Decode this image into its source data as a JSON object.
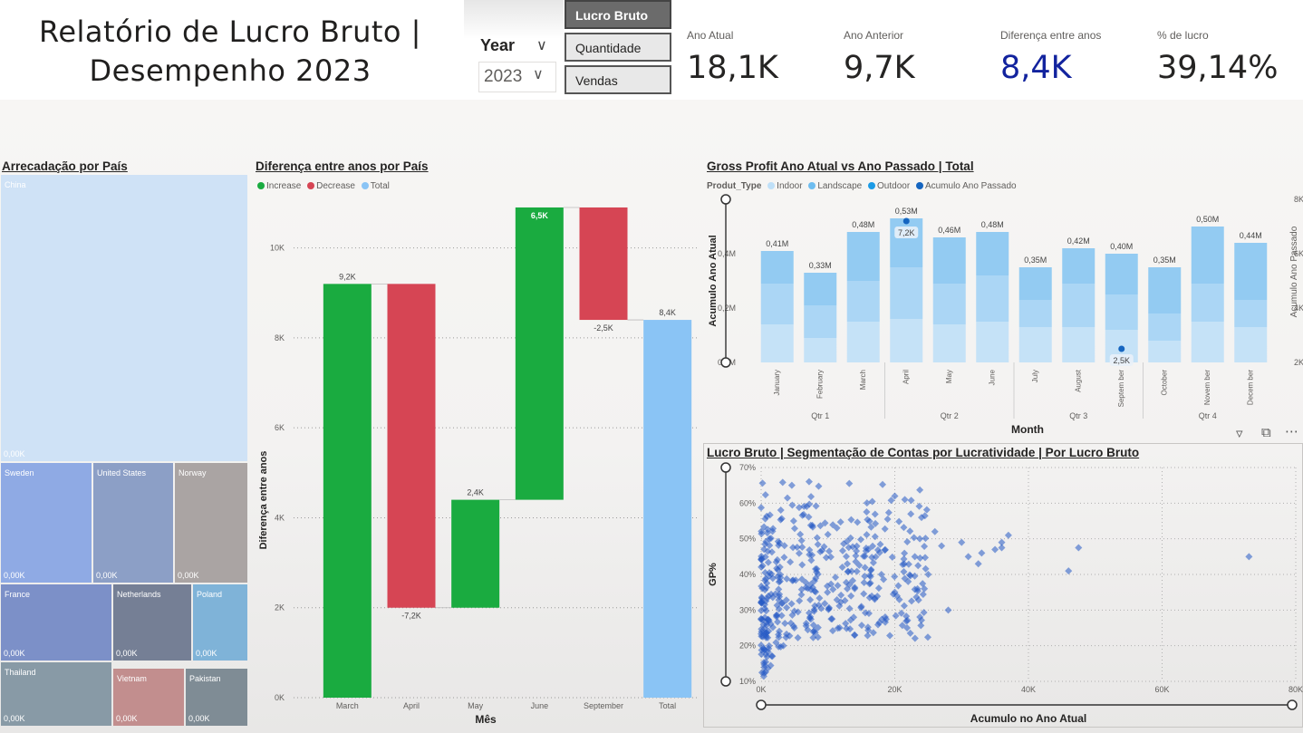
{
  "header": {
    "title_line1": "Relatório de Lucro Bruto |",
    "title_line2": "Desempenho 2023",
    "year_slicer": {
      "label": "Year",
      "value": "2023"
    },
    "measure_buttons": [
      {
        "label": "Lucro Bruto",
        "selected": true
      },
      {
        "label": "Quantidade",
        "selected": false
      },
      {
        "label": "Vendas",
        "selected": false
      }
    ],
    "kpis": [
      {
        "label": "Ano Atual",
        "value": "18,1K",
        "color": "#252423"
      },
      {
        "label": "Ano Anterior",
        "value": "9,7K",
        "color": "#252423"
      },
      {
        "label": "Diferença entre anos",
        "value": "8,4K",
        "color": "#12239e"
      },
      {
        "label": "% de lucro",
        "value": "39,14%",
        "color": "#252423"
      }
    ]
  },
  "treemap": {
    "title": "Arrecadação por País",
    "chart_data": {
      "type": "treemap",
      "title": "Arrecadação por País",
      "items": [
        {
          "name": "China",
          "value_label": "0,00K",
          "color": "#cfe2f6"
        },
        {
          "name": "Sweden",
          "value_label": "0,00K",
          "color": "#8faae4"
        },
        {
          "name": "United States",
          "value_label": "0,00K",
          "color": "#8c9fc6"
        },
        {
          "name": "Norway",
          "value_label": "0,00K",
          "color": "#aaa4a3"
        },
        {
          "name": "France",
          "value_label": "0,00K",
          "color": "#7c90c8"
        },
        {
          "name": "Netherlands",
          "value_label": "0,00K",
          "color": "#757f95"
        },
        {
          "name": "Poland",
          "value_label": "0,00K",
          "color": "#7fb3d8"
        },
        {
          "name": "Thailand",
          "value_label": "0,00K",
          "color": "#889aa6"
        },
        {
          "name": "Vietnam",
          "value_label": "0,00K",
          "color": "#c28e8e"
        },
        {
          "name": "Pakistan",
          "value_label": "0,00K",
          "color": "#7f8c95"
        }
      ]
    }
  },
  "waterfall": {
    "title": "Diferença entre anos por País",
    "legend": [
      {
        "label": "Increase",
        "color": "#1aab40"
      },
      {
        "label": "Decrease",
        "color": "#d64554"
      },
      {
        "label": "Total",
        "color": "#8ac4f5"
      }
    ],
    "chart_data": {
      "type": "waterfall",
      "title": "Diferença entre anos por País",
      "xlabel": "Mês",
      "ylabel": "Diferença entre anos",
      "ylim": [
        0,
        11000
      ],
      "yticks": [
        0,
        2000,
        4000,
        6000,
        8000,
        10000
      ],
      "ytick_labels": [
        "0K",
        "2K",
        "4K",
        "6K",
        "8K",
        "10K"
      ],
      "categories": [
        "March",
        "April",
        "May",
        "June",
        "September",
        "Total"
      ],
      "steps": [
        {
          "category": "March",
          "start": 0,
          "end": 9200,
          "label": "9,2K",
          "kind": "Increase"
        },
        {
          "category": "April",
          "start": 9200,
          "end": 2000,
          "label": "-7,2K",
          "kind": "Decrease"
        },
        {
          "category": "May",
          "start": 2000,
          "end": 4400,
          "label": "2,4K",
          "kind": "Increase"
        },
        {
          "category": "June",
          "start": 4400,
          "end": 10900,
          "label": "6,5K",
          "kind": "Increase"
        },
        {
          "category": "September",
          "start": 10900,
          "end": 8400,
          "label": "-2,5K",
          "kind": "Decrease"
        },
        {
          "category": "Total",
          "start": 0,
          "end": 8400,
          "label": "8,4K",
          "kind": "Total"
        }
      ]
    }
  },
  "combo": {
    "title": "Gross Profit Ano Atual vs Ano Passado | Total",
    "legend_title": "Produt_Type",
    "legend": [
      {
        "label": "Indoor",
        "color": "#bfe0f8"
      },
      {
        "label": "Landscape",
        "color": "#6ebdf0"
      },
      {
        "label": "Outdoor",
        "color": "#1c9be6"
      },
      {
        "label": "Acumulo Ano Passado",
        "color": "#1565c0"
      }
    ],
    "chart_data": {
      "type": "bar",
      "title": "Gross Profit Ano Atual vs Ano Passado | Total",
      "xlabel": "Month",
      "ylabel": "Acumulo Ano Atual",
      "y2label": "Acumulo Ano Passado",
      "ylim": [
        0,
        0.6
      ],
      "yticks": [
        0,
        0.2,
        0.4
      ],
      "ytick_labels": [
        "0,0M",
        "0,2M",
        "0,4M"
      ],
      "y2lim": [
        2000,
        8000
      ],
      "y2ticks": [
        2000,
        4000,
        6000,
        8000
      ],
      "y2tick_labels": [
        "2K",
        "4K",
        "6K",
        "8K"
      ],
      "categories": [
        "January",
        "February",
        "March",
        "April",
        "May",
        "June",
        "July",
        "August",
        "September",
        "October",
        "November",
        "December"
      ],
      "category_labels": [
        "January",
        "February",
        "March",
        "April",
        "May",
        "June",
        "July",
        "August",
        "Septem ber",
        "October",
        "Novem ber",
        "Decem ber"
      ],
      "quarters": [
        "Qtr 1",
        "Qtr 2",
        "Qtr 3",
        "Qtr 4"
      ],
      "series": [
        {
          "name": "Indoor",
          "values": [
            0.14,
            0.09,
            0.15,
            0.16,
            0.14,
            0.15,
            0.13,
            0.13,
            0.12,
            0.08,
            0.15,
            0.13
          ]
        },
        {
          "name": "Landscape",
          "values": [
            0.15,
            0.12,
            0.15,
            0.19,
            0.15,
            0.17,
            0.1,
            0.16,
            0.13,
            0.1,
            0.14,
            0.1
          ]
        },
        {
          "name": "Outdoor",
          "values": [
            0.12,
            0.12,
            0.18,
            0.18,
            0.17,
            0.16,
            0.12,
            0.13,
            0.15,
            0.17,
            0.21,
            0.21
          ]
        }
      ],
      "total_labels": [
        "0,41M",
        "0,33M",
        "0,48M",
        "0,53M",
        "0,46M",
        "0,48M",
        "0,35M",
        "0,42M",
        "0,40M",
        "0,35M",
        "0,50M",
        "0,44M"
      ],
      "line_series": {
        "name": "Acumulo Ano Passado",
        "points": [
          {
            "category": "April",
            "value": 7200,
            "label": "7,2K"
          },
          {
            "category": "September",
            "value": 2500,
            "label": "2,5K"
          }
        ]
      }
    }
  },
  "scatter": {
    "title": "Lucro Bruto | Segmentação de Contas por Lucratividade | Por Lucro Bruto",
    "chart_data": {
      "type": "scatter",
      "title": "Lucro Bruto | Segmentação de Contas por Lucratividade | Por Lucro Bruto",
      "xlabel": "Acumulo no Ano Atual",
      "ylabel": "GP%",
      "xlim": [
        0,
        80000
      ],
      "xticks": [
        0,
        20000,
        40000,
        60000,
        80000
      ],
      "xtick_labels": [
        "0K",
        "20K",
        "40K",
        "60K",
        "80K"
      ],
      "ylim": [
        10,
        70
      ],
      "yticks": [
        10,
        20,
        30,
        40,
        50,
        60,
        70
      ],
      "ytick_labels": [
        "10%",
        "20%",
        "30%",
        "40%",
        "50%",
        "60%",
        "70%"
      ],
      "color": "#2358c5",
      "highlighted_points": [
        {
          "x": 37000,
          "y": 51
        },
        {
          "x": 36000,
          "y": 49
        },
        {
          "x": 35000,
          "y": 47
        },
        {
          "x": 33000,
          "y": 46
        },
        {
          "x": 31000,
          "y": 45
        },
        {
          "x": 32500,
          "y": 43
        },
        {
          "x": 36000,
          "y": 47.5
        },
        {
          "x": 47500,
          "y": 47.5
        },
        {
          "x": 46000,
          "y": 41
        },
        {
          "x": 73000,
          "y": 45
        },
        {
          "x": 28000,
          "y": 30
        },
        {
          "x": 30000,
          "y": 49
        },
        {
          "x": 26000,
          "y": 52
        },
        {
          "x": 21500,
          "y": 61
        },
        {
          "x": 20000,
          "y": 62
        },
        {
          "x": 24000,
          "y": 56
        },
        {
          "x": 27000,
          "y": 48
        },
        {
          "x": 18000,
          "y": 40
        },
        {
          "x": 22000,
          "y": 38
        },
        {
          "x": 25000,
          "y": 40
        },
        {
          "x": 23000,
          "y": 45
        },
        {
          "x": 20000,
          "y": 35
        },
        {
          "x": 17000,
          "y": 33
        },
        {
          "x": 15000,
          "y": 31
        },
        {
          "x": 14000,
          "y": 36
        }
      ],
      "cluster_description": "several hundred accounts concentrated between 0K and 20K on x and 10%-70% on y",
      "cluster": {
        "n": 420,
        "x_max": 25000,
        "y_min": 10,
        "y_max": 70,
        "seed": 7
      }
    }
  }
}
